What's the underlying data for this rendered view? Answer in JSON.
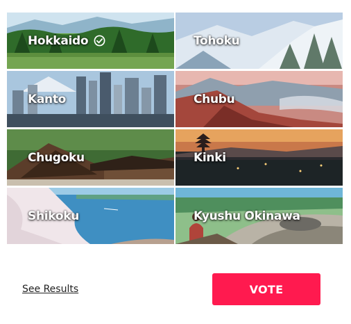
{
  "regions": [
    {
      "id": "hokkaido",
      "label": "Hokkaido",
      "selected": true
    },
    {
      "id": "tohoku",
      "label": "Tohoku",
      "selected": false
    },
    {
      "id": "kanto",
      "label": "Kanto",
      "selected": false
    },
    {
      "id": "chubu",
      "label": "Chubu",
      "selected": false
    },
    {
      "id": "chugoku",
      "label": "Chugoku",
      "selected": false
    },
    {
      "id": "kinki",
      "label": "Kinki",
      "selected": false
    },
    {
      "id": "shikoku",
      "label": "Shikoku",
      "selected": false
    },
    {
      "id": "kyushu-okinawa",
      "label": "Kyushu Okinawa",
      "selected": false
    }
  ],
  "actions": {
    "see_results_label": "See Results",
    "vote_label": "VOTE"
  },
  "colors": {
    "vote_button": "#ff1a4f",
    "label_text": "#ffffff"
  },
  "icons": {
    "selected": "check-circle-icon"
  }
}
